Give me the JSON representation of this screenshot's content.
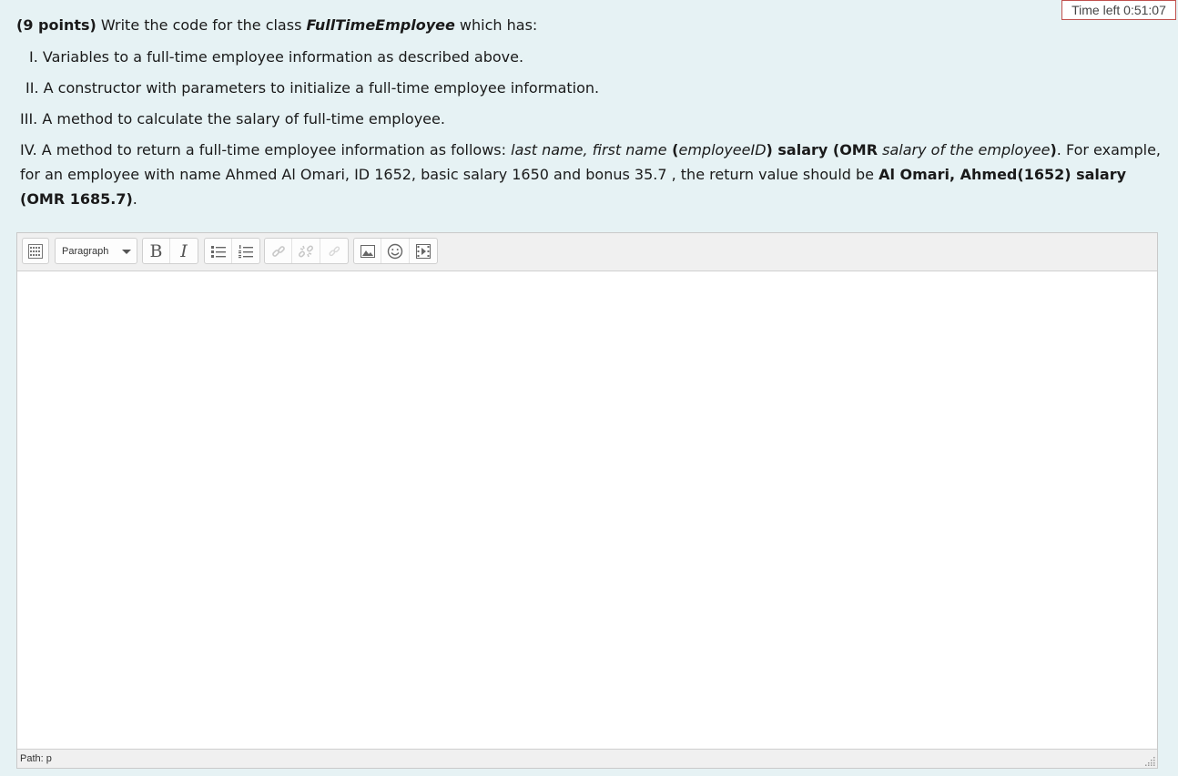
{
  "timer": {
    "label": "Time left 0:51:07"
  },
  "question": {
    "points": "(9 points)",
    "intro": " Write the code for the class ",
    "class_name": "FullTimeEmployee",
    "intro_end": " which has:",
    "items": {
      "i1": "I. Variables to a full-time employee information as described above.",
      "i2": "II. A constructor with parameters to initialize a full-time employee information.",
      "i3": "III. A method to calculate the salary of full-time employee.",
      "i4_a": "IV. A method to return a full-time employee information as follows: ",
      "i4_b": "last name, first name",
      "i4_c": " (",
      "i4_d": "employeeID",
      "i4_e": ") salary (OMR",
      "i4_f": " salary of the employee",
      "i4_g": ")",
      "i4_h": ". For example, for an employee with name Ahmed Al Omari, ID 1652, basic salary 1650 and bonus 35.7 , the return value should be ",
      "i4_i": "Al Omari, Ahmed(1652) salary (OMR 1685.7)",
      "i4_j": "."
    }
  },
  "editor": {
    "format_select": "Paragraph",
    "bold_label": "B",
    "italic_label": "I",
    "status_path": "Path: p",
    "icons": [
      "toolbar-toggle-icon",
      "bold-icon",
      "italic-icon",
      "bullet-list-icon",
      "numbered-list-icon",
      "link-icon",
      "unlink-icon",
      "anchor-icon",
      "image-icon",
      "emoticon-icon",
      "media-icon",
      "resize-grip-icon"
    ]
  }
}
